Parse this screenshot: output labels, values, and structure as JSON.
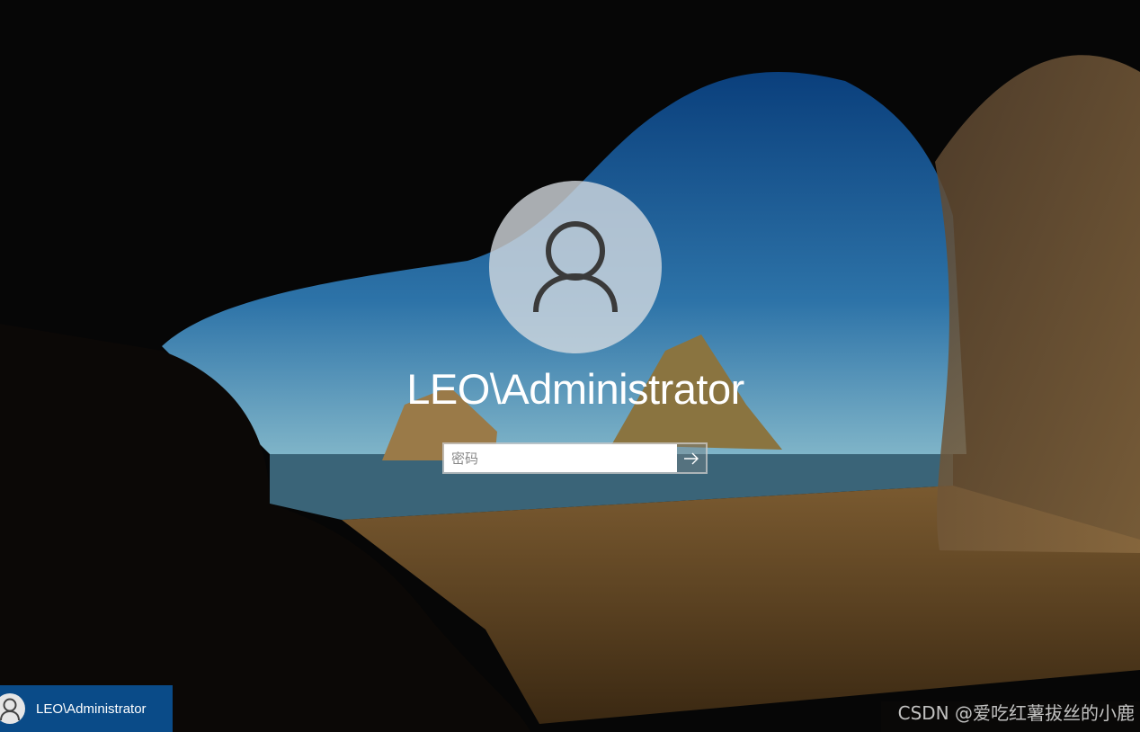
{
  "user": {
    "display_name": "LEO\\Administrator"
  },
  "password": {
    "placeholder": "密码",
    "value": ""
  },
  "submit": {
    "icon": "arrow-right-icon"
  },
  "user_tile": {
    "label": "LEO\\Administrator",
    "color": "#0a4b88"
  },
  "watermark": "CSDN @爱吃红薯拔丝的小鹿"
}
